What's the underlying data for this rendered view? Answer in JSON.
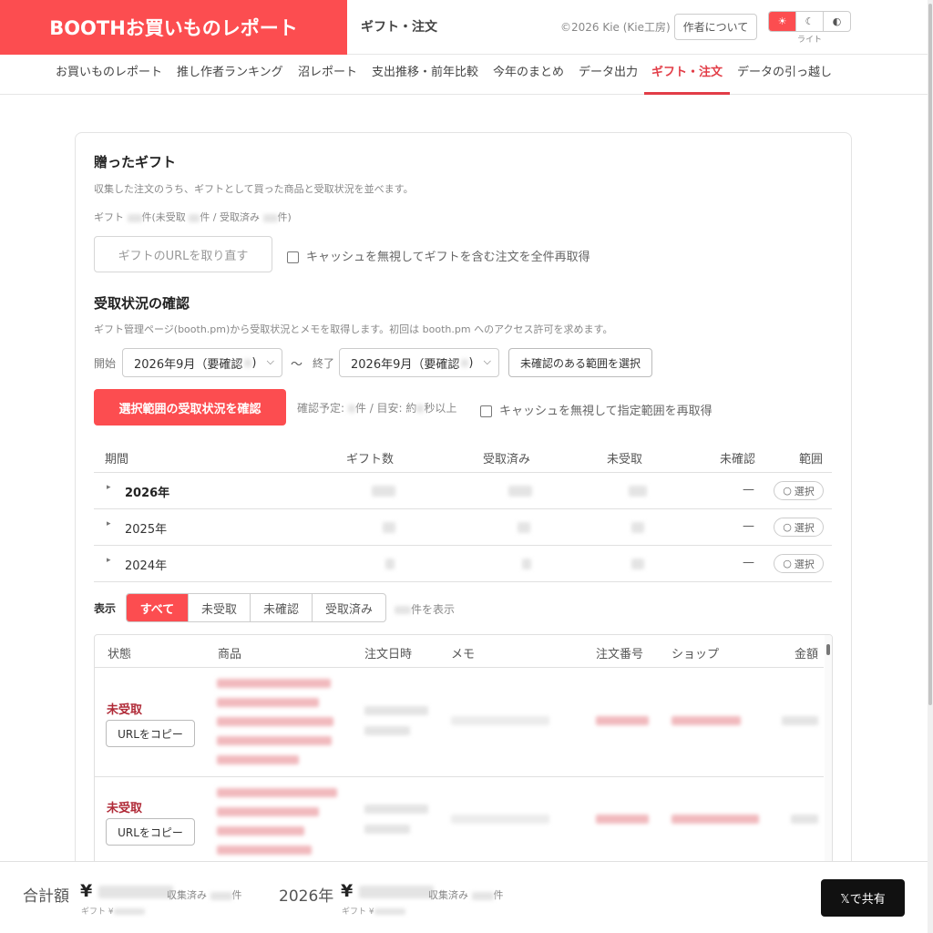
{
  "header": {
    "brand": "BOOTHお買いものレポート",
    "subtitle": "ギフト・注文",
    "copyright": "©2026 Kie (Kie工房)",
    "about_button": "作者について",
    "theme": {
      "light_icon": "☀",
      "dark_icon": "☾",
      "auto_icon": "◐",
      "label": "ライト"
    }
  },
  "nav": {
    "tabs": [
      {
        "label": "お買いものレポート"
      },
      {
        "label": "推し作者ランキング"
      },
      {
        "label": "沼レポート"
      },
      {
        "label": "支出推移・前年比較"
      },
      {
        "label": "今年のまとめ"
      },
      {
        "label": "データ出力"
      },
      {
        "label": "ギフト・注文"
      },
      {
        "label": "データの引っ越し"
      }
    ],
    "active_index": 6
  },
  "gifts": {
    "title": "贈ったギフト",
    "description": "収集した注文のうち、ギフトとして買った商品と受取状況を並べます。",
    "count_prefix": "ギフト",
    "count_mid1": "件(未受取",
    "count_mid2": "件 / 受取済み",
    "count_suffix": "件)",
    "refetch_button": "ギフトのURLを取り直す",
    "refetch_all_label": "キャッシュを無視してギフトを含む注文を全件再取得"
  },
  "receipt": {
    "title": "受取状況の確認",
    "description": "ギフト管理ページ(booth.pm)から受取状況とメモを取得します。初回は booth.pm へのアクセス許可を求めます。",
    "start_label": "開始",
    "start_value": "2026年9月（要確認",
    "range_sep": "〜",
    "end_label": "終了",
    "end_value": "2026年9月（要確認",
    "select_unconfirmed_button": "未確認のある範囲を選択",
    "confirm_button": "選択範囲の受取状況を確認",
    "estimate_prefix": "確認予定:",
    "estimate_mid": "件 / 目安: 約",
    "estimate_suffix": "秒以上",
    "refetch_range_label": "キャッシュを無視して指定範囲を再取得"
  },
  "summary_table": {
    "headers": [
      "期間",
      "ギフト数",
      "受取済み",
      "未受取",
      "未確認",
      "範囲"
    ],
    "rows": [
      {
        "period": "2026年",
        "unconfirmed": "—",
        "select": "選択"
      },
      {
        "period": "2025年",
        "unconfirmed": "—",
        "select": "選択"
      },
      {
        "period": "2024年",
        "unconfirmed": "—",
        "select": "選択"
      }
    ]
  },
  "filter": {
    "label": "表示",
    "options": [
      "すべて",
      "未受取",
      "未確認",
      "受取済み"
    ],
    "selected": "すべて",
    "count_suffix": "件を表示"
  },
  "orders_table": {
    "headers": [
      "状態",
      "商品",
      "注文日時",
      "メモ",
      "注文番号",
      "ショップ",
      "金額"
    ],
    "rows": [
      {
        "status": "未受取",
        "copy_button": "URLをコピー"
      },
      {
        "status": "未受取",
        "copy_button": "URLをコピー"
      }
    ]
  },
  "footer": {
    "total_label": "合計額",
    "currency": "¥",
    "collected_label": "収集済み",
    "count_suffix": "件",
    "gift_label": "ギフト ¥",
    "year_label": "2026年",
    "share_button": "𝕏で共有"
  },
  "colors": {
    "brand": "#fc4d50",
    "active_tab": "#e23d47",
    "status_unreceived": "#b02a37"
  }
}
